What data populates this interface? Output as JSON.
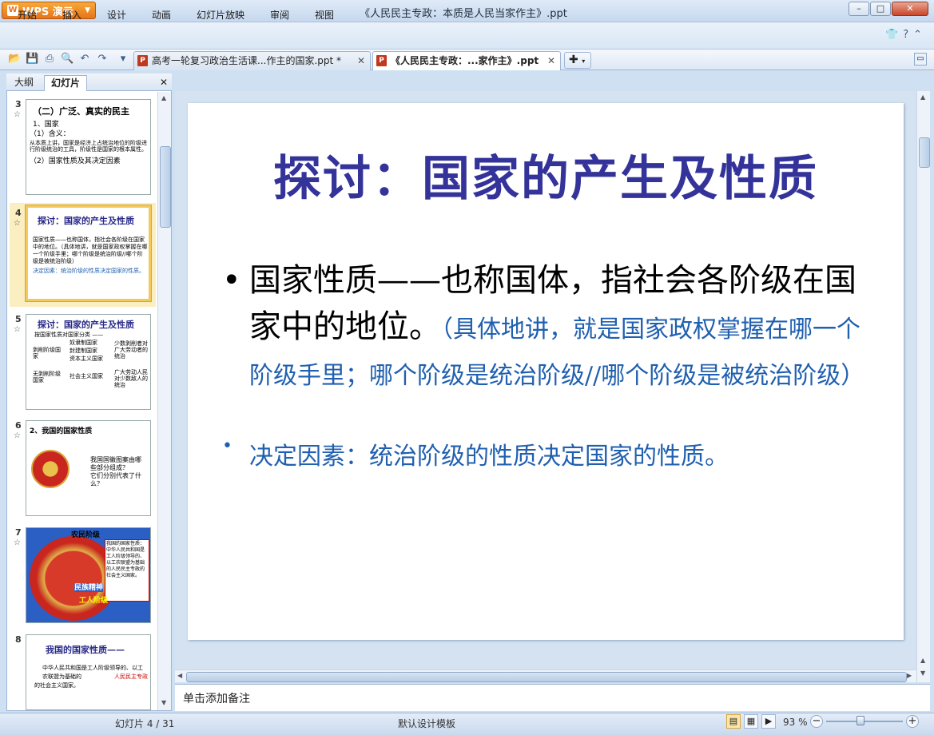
{
  "app": {
    "name": "WPS 演示",
    "window_title": "《人民民主专政：本质是人民当家作主》.ppt"
  },
  "menu": [
    "开始",
    "插入",
    "设计",
    "动画",
    "幻灯片放映",
    "审阅",
    "视图"
  ],
  "tabs": [
    {
      "label": "高考一轮复习政治生活课...作主的国家.ppt *"
    },
    {
      "label": "《人民民主专政：...家作主》.ppt"
    }
  ],
  "left_panel": {
    "tab_outline": "大纲",
    "tab_slides": "幻灯片"
  },
  "thumbnails": [
    {
      "num": "3",
      "title": "（二）广泛、真实的民主",
      "lines": [
        "1、国家",
        "（1）含义：",
        "从本质上讲，国家是经济上占统治地位的阶级进行阶级统治的工具，阶级性是国家的根本属性。",
        "（2）国家性质及其决定因素"
      ]
    },
    {
      "num": "4",
      "title": "探讨：国家的产生及性质",
      "lines": [
        "国家性质——也称国体，指社会各阶级在国家中的地位。（具体地讲，就是国家政权掌握在哪一个阶级手里；哪个阶级是统治阶级//哪个阶级是被统治阶级）",
        "决定因素：统治阶级的性质决定国家的性质。"
      ]
    },
    {
      "num": "5",
      "title": "探讨：国家的产生及性质",
      "lines": [
        "按国家性质对国家分类 ——",
        "剥削阶级国家",
        "奴隶制国家",
        "封建制国家",
        "资本主义国家",
        "少数剥削者对广大劳动者的统治",
        "无剥削阶级国家",
        "社会主义国家",
        "广大劳动人民对少数敌人的统治"
      ]
    },
    {
      "num": "6",
      "title": "2、我国的国家性质",
      "lines": [
        "我国国徽图案由哪些部分组成？",
        "它们分别代表了什么？"
      ]
    },
    {
      "num": "7",
      "title": "",
      "lines": [
        "农民阶级",
        "我国的国家性质：中华人民共和国是工人阶级领导的、以工农联盟为基础的人民民主专政的社会主义国家。",
        "民族精神",
        "工人阶级"
      ]
    },
    {
      "num": "8",
      "title": "我国的国家性质——",
      "lines": [
        "中华人民共和国是工人阶级领导的、以工农联盟为基础的",
        "人民民主专政",
        "的社会主义国家。"
      ]
    }
  ],
  "slide": {
    "title": "探讨：国家的产生及性质",
    "bullet1_main": "国家性质——也称国体，指社会各阶级在国家中的地位。",
    "bullet1_note": "（具体地讲，就是国家政权掌握在哪一个阶级手里；哪个阶级是统治阶级//哪个阶级是被统治阶级）",
    "bullet2": "决定因素：统治阶级的性质决定国家的性质。"
  },
  "notes_placeholder": "单击添加备注",
  "status": {
    "slide": "幻灯片 4 / 31",
    "template": "默认设计模板",
    "zoom": "93 %"
  },
  "colors": {
    "title_color": "#33339a",
    "note_color": "#2060b0",
    "accent": "#e5741a"
  }
}
